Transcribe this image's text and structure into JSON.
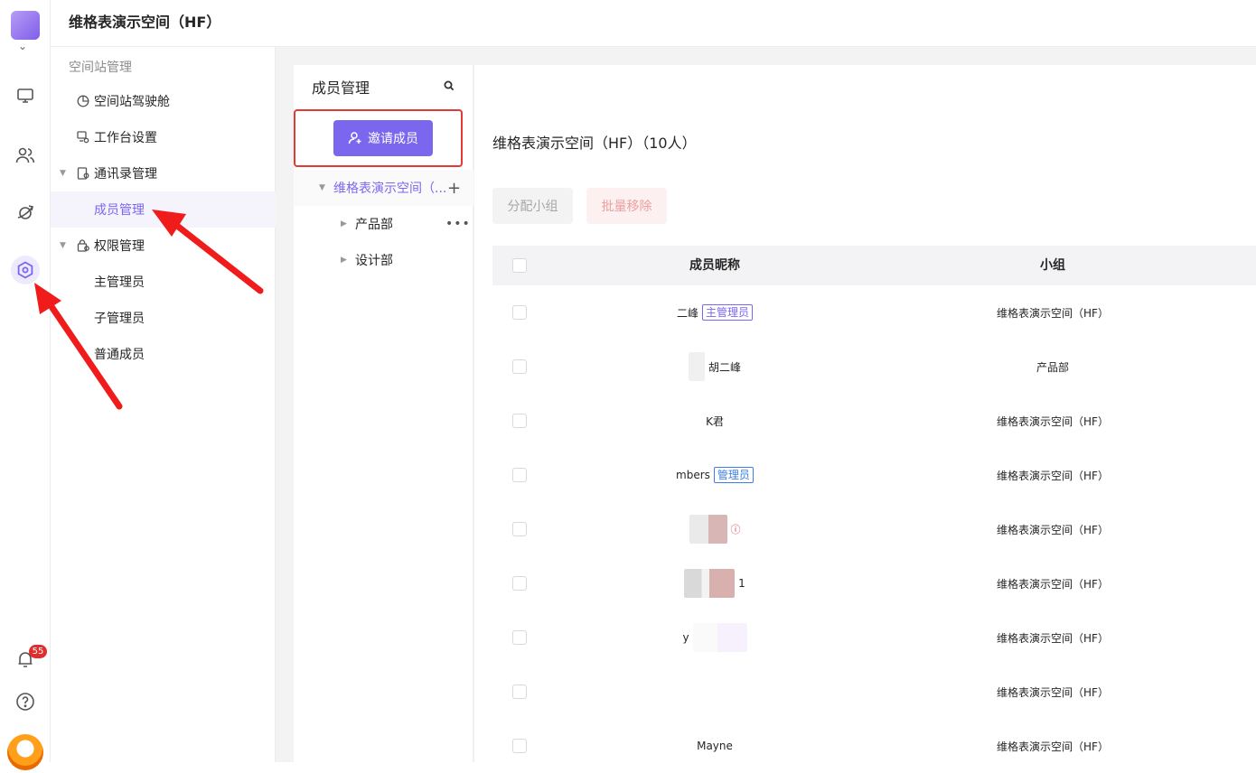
{
  "space_title": "维格表演示空间（HF）",
  "rail": {
    "notification_count": "55",
    "icons": [
      "workbench-icon",
      "contacts-icon",
      "explore-icon",
      "settings-icon",
      "bell-icon",
      "help-icon"
    ]
  },
  "nav": {
    "section_title": "空间站管理",
    "items": [
      {
        "label": "空间站驾驶舱",
        "icon": "dashboard-icon"
      },
      {
        "label": "工作台设置",
        "icon": "workbench-settings-icon"
      },
      {
        "label": "通讯录管理",
        "icon": "contacts-manage-icon"
      },
      {
        "label": "成员管理",
        "icon": ""
      },
      {
        "label": "权限管理",
        "icon": "permission-icon"
      },
      {
        "label": "主管理员",
        "icon": ""
      },
      {
        "label": "子管理员",
        "icon": ""
      },
      {
        "label": "普通成员",
        "icon": ""
      }
    ]
  },
  "member_panel": {
    "title": "成员管理",
    "invite_label": "邀请成员",
    "tree": {
      "root_label": "维格表演示空间（...",
      "children": [
        "产品部",
        "设计部"
      ]
    }
  },
  "main": {
    "title": "维格表演示空间（HF）（10人）",
    "assign_label": "分配小组",
    "remove_label": "批量移除",
    "columns": [
      "成员昵称",
      "小组"
    ],
    "rows": [
      {
        "name": "二峰",
        "tag": "主管理员",
        "tag_type": "owner",
        "group": "维格表演示空间（HF）"
      },
      {
        "name": "胡二峰",
        "tag": "",
        "tag_type": "",
        "group": "产品部"
      },
      {
        "name": "K君",
        "tag": "",
        "tag_type": "",
        "group": "维格表演示空间（HF）"
      },
      {
        "name": "mbers",
        "tag": "管理员",
        "tag_type": "admin",
        "group": "维格表演示空间（HF）"
      },
      {
        "name": "",
        "tag": "",
        "tag_type": "warn",
        "group": "维格表演示空间（HF）"
      },
      {
        "name": "1",
        "tag": "",
        "tag_type": "",
        "group": "维格表演示空间（HF）"
      },
      {
        "name": "y",
        "tag": "",
        "tag_type": "",
        "group": "维格表演示空间（HF）"
      },
      {
        "name": "",
        "tag": "",
        "tag_type": "",
        "group": "维格表演示空间（HF）"
      },
      {
        "name": "Mayne",
        "tag": "",
        "tag_type": "",
        "group": "维格表演示空间（HF）"
      }
    ]
  },
  "colors": {
    "accent": "#7b67ee",
    "danger": "#e53935",
    "owner_tag": "#7b67ee",
    "admin_tag": "#3d7ee6"
  }
}
